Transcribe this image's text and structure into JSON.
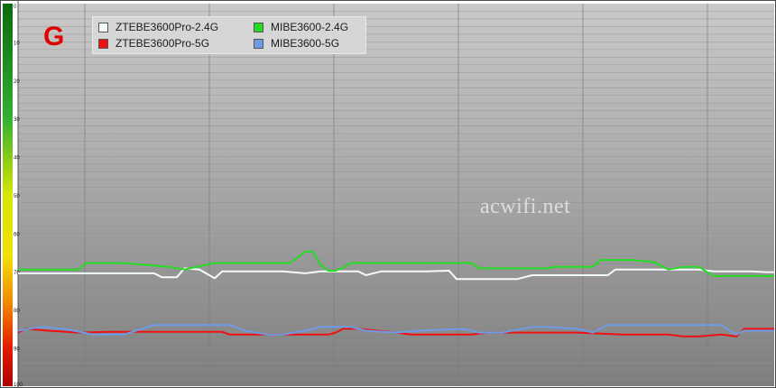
{
  "band_label": "G",
  "watermark": "acwifi.net",
  "legend": [
    {
      "label": "ZTEBE3600Pro-2.4G",
      "color": "#f4fbfb"
    },
    {
      "label": "MIBE3600-2.4G",
      "color": "#22dd22"
    },
    {
      "label": "ZTEBE3600Pro-5G",
      "color": "#ee1111"
    },
    {
      "label": "MIBE3600-5G",
      "color": "#6f9ae6"
    }
  ],
  "chart_data": {
    "type": "line",
    "ylim": [
      0,
      100
    ],
    "y_inverted": true,
    "yticks": [
      "0",
      "10",
      "20",
      "30",
      "40",
      "50",
      "60",
      "70",
      "80",
      "90",
      "100"
    ],
    "grid": true,
    "legend_position": "top-left",
    "series": [
      {
        "name": "ZTEBE3600Pro-2.4G",
        "color": "#f4fbfb",
        "x": [
          0,
          15,
          18,
          19,
          21,
          22,
          24,
          26,
          27,
          35,
          38,
          40,
          45,
          46,
          48,
          50,
          54,
          57,
          58,
          60,
          66,
          68,
          69,
          74,
          78,
          79,
          80,
          90,
          92,
          95,
          97,
          99,
          100
        ],
        "values": [
          70.5,
          70.5,
          70.5,
          71.5,
          71.5,
          69.2,
          69.5,
          71.8,
          70,
          70,
          70.5,
          70,
          70,
          71,
          70,
          70,
          70,
          69.8,
          72,
          72,
          72,
          71,
          71,
          71,
          71,
          69.5,
          69.5,
          69.5,
          70,
          70,
          70,
          70.2,
          70.2
        ]
      },
      {
        "name": "MIBE3600-2.4G",
        "color": "#22dd22",
        "x": [
          0,
          8,
          9,
          14,
          20,
          22,
          26,
          27,
          36,
          38,
          39,
          40,
          41,
          42,
          43,
          44,
          60,
          61,
          70,
          71,
          76,
          77,
          79,
          81,
          84,
          86,
          88,
          90,
          91,
          92,
          100
        ],
        "values": [
          69.5,
          69.5,
          67.8,
          67.8,
          68.8,
          69.5,
          67.8,
          67.8,
          67.8,
          64.8,
          64.8,
          68.2,
          69.8,
          69.8,
          69,
          67.8,
          67.8,
          69.2,
          69.2,
          68.8,
          68.8,
          67,
          67,
          67,
          67.5,
          69.5,
          68.8,
          68.8,
          70,
          71.2,
          71.2
        ]
      },
      {
        "name": "ZTEBE3600Pro-5G",
        "color": "#ee1111",
        "x": [
          0,
          1,
          4,
          8,
          12,
          27,
          28,
          41,
          42,
          43,
          45,
          50,
          52,
          56,
          58,
          60,
          62,
          67,
          72,
          74,
          80,
          82,
          86,
          88,
          90,
          93,
          95,
          96,
          100
        ],
        "values": [
          86,
          85,
          85.5,
          86,
          85.8,
          85.8,
          86.5,
          86.5,
          86,
          85,
          85,
          86,
          86.5,
          86.5,
          86.5,
          86.5,
          86,
          86,
          86,
          86,
          86.5,
          86.5,
          86.5,
          87,
          87,
          86.5,
          87,
          85,
          85
        ]
      },
      {
        "name": "MIBE3600-5G",
        "color": "#6f9ae6",
        "x": [
          0,
          3,
          6,
          10,
          14,
          18,
          20,
          28,
          30,
          33,
          35,
          38,
          40,
          44,
          46,
          50,
          53,
          59,
          61,
          64,
          68,
          70,
          74,
          76,
          78,
          91,
          93,
          95,
          96,
          100
        ],
        "values": [
          85.5,
          84.5,
          85,
          86.5,
          86.5,
          84,
          84,
          84,
          85.5,
          86.5,
          86.5,
          85.5,
          84.5,
          84.5,
          85.5,
          86,
          85.5,
          85,
          86,
          86,
          84.5,
          84.5,
          85,
          86,
          84,
          84,
          84,
          86.5,
          85.5,
          85.5
        ]
      }
    ]
  }
}
